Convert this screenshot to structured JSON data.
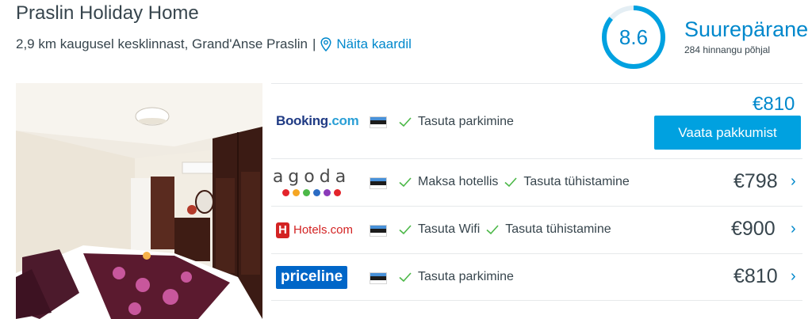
{
  "hotel": {
    "name": "Praslin Holiday Home",
    "location": "2,9 km kaugusel kesklinnast, Grand'Anse Praslin",
    "separator": "|",
    "map_link": "Näita kaardil"
  },
  "rating": {
    "score": "8.6",
    "word": "Suurepärane",
    "count": "284 hinnangu põhjal",
    "score_fraction": 0.86
  },
  "photo": {
    "icon": "room-photo"
  },
  "offers": [
    {
      "provider": "Booking.com",
      "logo_parts": [
        "Booking",
        ".com"
      ],
      "features": [
        "Tasuta parkimine"
      ],
      "price": "€810",
      "cta": "Vaata pakkumist"
    },
    {
      "provider": "agoda",
      "logo_dots": [
        "#e3242b",
        "#f5a623",
        "#4cb848",
        "#2b6cc4",
        "#8a3ab9",
        "#e3242b"
      ],
      "features": [
        "Maksa hotellis",
        "Tasuta tühistamine"
      ],
      "price": "€798",
      "chevron": "›"
    },
    {
      "provider": "Hotels.com",
      "logo_mark": "H",
      "logo_text": "Hotels.com",
      "features": [
        "Tasuta Wifi",
        "Tasuta tühistamine"
      ],
      "price": "€900",
      "chevron": "›"
    },
    {
      "provider": "priceline",
      "logo_text": "priceline",
      "features": [
        "Tasuta parkimine"
      ],
      "price": "€810",
      "chevron": "›"
    }
  ],
  "colors": {
    "accent": "#0088cc",
    "button": "#00a1e0",
    "check": "#4cb848",
    "text": "#37454d"
  }
}
